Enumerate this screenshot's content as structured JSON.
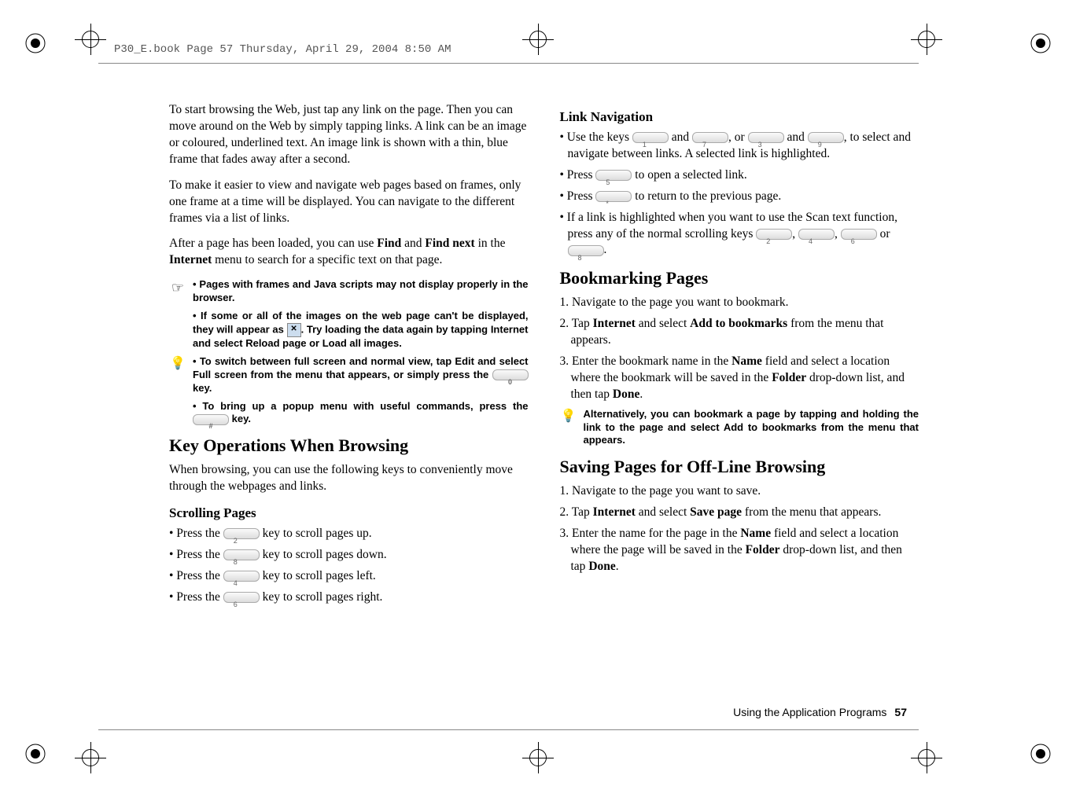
{
  "header": "P30_E.book  Page 57  Thursday, April 29, 2004  8:50 AM",
  "left": {
    "p1": "To start browsing the Web, just tap any link on the page.  Then you can move around on the Web by simply tapping links.  A link can be an image or coloured, underlined text.  An image link is shown with a thin, blue frame that fades away after a second.",
    "p2": "To make it easier to view and navigate web pages based on frames, only one frame at a time will be displayed.  You can navigate to the different frames via a list of links.",
    "p3a": "After a page has been loaded, you can use ",
    "p3b": "Find",
    "p3c": " and ",
    "p3d": "Find next",
    "p3e": " in the ",
    "p3f": "Internet",
    "p3g": " menu to search for a specific text on that page.",
    "note1": "• Pages with frames and Java scripts may not display properly in the browser.",
    "note2a": "• If some or all of the images on the web page can't be displayed, they will appear as ",
    "note2b": ". Try loading the data again by tapping Internet and select Reload page or Load all images.",
    "note3a": "• To switch between full screen and normal view, tap Edit and select Full screen from the menu that appears, or simply press the ",
    "note3b": " key.",
    "note4a": "• To bring up a popup menu with useful commands, press the ",
    "note4b": " key.",
    "h2": "Key Operations When Browsing",
    "h2p": "When browsing, you can use the following keys to conveniently move through the webpages and links.",
    "h3": "Scrolling Pages",
    "s1a": "• Press the ",
    "s1b": " key to scroll pages up.",
    "s2a": "• Press the ",
    "s2b": " key to scroll pages down.",
    "s3a": "• Press the ",
    "s3b": " key to scroll pages left.",
    "s4a": "• Press the ",
    "s4b": " key to scroll pages right."
  },
  "right": {
    "h3a": "Link Navigation",
    "l1a": "• Use the keys ",
    "l1b": " and ",
    "l1c": ", or ",
    "l1d": " and ",
    "l1e": ", to select and navigate between links. A selected link is highlighted.",
    "l2a": "• Press ",
    "l2b": " to open a selected link.",
    "l3a": "• Press ",
    "l3b": " to return to the previous page.",
    "l4a": "• If a link is highlighted when you want to use the Scan text function, press any of the normal scrolling keys ",
    "l4b": ", ",
    "l4c": ", ",
    "l4d": " or ",
    "l4e": ".",
    "h2a": "Bookmarking Pages",
    "b1": "1. Navigate to the page you want to bookmark.",
    "b2a": "2. Tap ",
    "b2b": "Internet",
    "b2c": " and select ",
    "b2d": "Add to bookmarks",
    "b2e": " from the menu that appears.",
    "b3a": "3. Enter the bookmark name in the ",
    "b3b": "Name",
    "b3c": " field and select a location where the bookmark will be saved in the ",
    "b3d": "Folder",
    "b3e": " drop-down list, and then tap ",
    "b3f": "Done",
    "b3g": ".",
    "tip": "Alternatively, you can bookmark a page by tapping and holding the link to the page and select Add to bookmarks from the menu that appears.",
    "h2b": "Saving Pages for Off-Line Browsing",
    "s1": "1. Navigate to the page you want to save.",
    "s2a": "2. Tap ",
    "s2b": "Internet",
    "s2c": " and select ",
    "s2d": "Save page",
    "s2e": " from the menu that appears.",
    "s3a": "3. Enter the name for the page in the ",
    "s3b": "Name",
    "s3c": " field and select a location where the page will be saved in the ",
    "s3d": "Folder",
    "s3e": " drop-down list, and then tap ",
    "s3f": "Done",
    "s3g": "."
  },
  "footer": {
    "text": "Using the Application Programs",
    "page": "57"
  },
  "keys": {
    "k0": "0",
    "k1": "1",
    "k2": "2",
    "k3": "3",
    "k4": "4",
    "k5": "5",
    "k6": "6",
    "k7": "7",
    "k8": "8",
    "k9": "9",
    "hash": "#",
    "star": "*"
  }
}
